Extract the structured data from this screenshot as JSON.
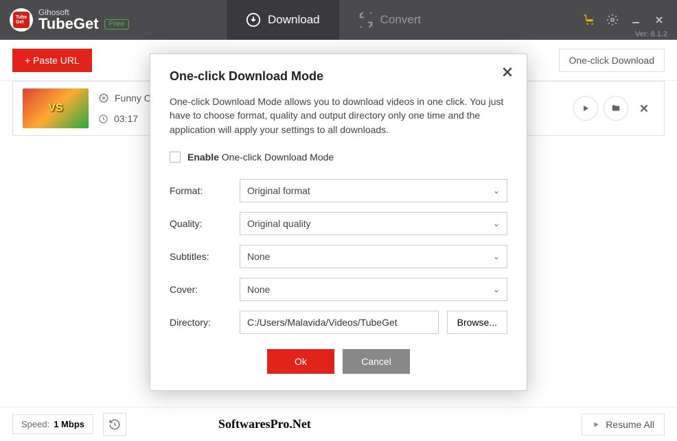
{
  "header": {
    "brand_sub": "Gihosoft",
    "brand_main": "TubeGet",
    "free_badge": "Free",
    "tabs": {
      "download": "Download",
      "convert": "Convert"
    },
    "version": "Ver: 8.1.2"
  },
  "toolbar": {
    "paste_label": "+ Paste URL",
    "oneclick_label": "One-click Download"
  },
  "item": {
    "title": "Funny Ca",
    "duration": "03:17"
  },
  "footer": {
    "speed_label": "Speed:",
    "speed_value": "1 Mbps",
    "watermark": "SoftwaresPro.Net",
    "resume_label": "Resume All"
  },
  "dialog": {
    "title": "One-click Download Mode",
    "description": "One-click Download Mode allows you to download videos in one click.  You just have to choose format,  quality and output directory only one time and the application will apply your settings to all downloads.",
    "enable_strong": "Enable",
    "enable_rest": " One-click Download Mode",
    "labels": {
      "format": "Format:",
      "quality": "Quality:",
      "subtitles": "Subtitles:",
      "cover": "Cover:",
      "directory": "Directory:"
    },
    "values": {
      "format": "Original format",
      "quality": "Original quality",
      "subtitles": "None",
      "cover": "None",
      "directory": "C:/Users/Malavida/Videos/TubeGet"
    },
    "browse": "Browse...",
    "ok": "Ok",
    "cancel": "Cancel"
  }
}
